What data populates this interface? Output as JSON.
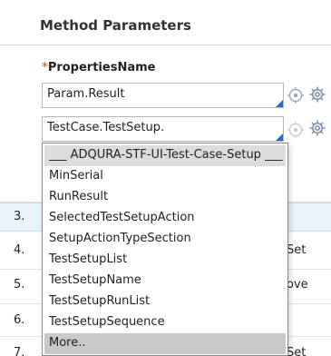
{
  "header": {
    "title": "Method Parameters"
  },
  "field": {
    "required_marker": "*",
    "label": "PropertiesName",
    "value_1": "Param.Result",
    "value_2": "TestCase.TestSetup."
  },
  "rows": {
    "numbers": [
      "3.",
      "4.",
      "5.",
      "6.",
      "7."
    ],
    "right_fragments": [
      "Set",
      "ove",
      "Set"
    ]
  },
  "dropdown": {
    "header": "___ ADQURA-STF-UI-Test-Case-Setup ___",
    "items": [
      "MinSerial",
      "RunResult",
      "SelectedTestSetupAction",
      "SetupActionTypeSection",
      "TestSetupList",
      "TestSetupName",
      "TestSetupRunList",
      "TestSetupSequence"
    ],
    "more": "More.."
  },
  "icons": [
    "crosshair-icon",
    "gear-icon"
  ],
  "colors": {
    "accent": "#1f6fcf",
    "required": "#e07a1a",
    "icon": "#9aa9c4",
    "selected_row": "#eaf3fc"
  }
}
